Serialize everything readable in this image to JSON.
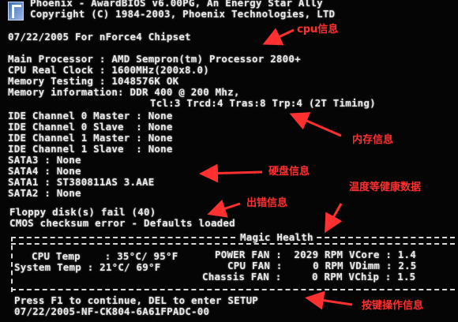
{
  "bios": {
    "header_line1": "Phoenix - AwardBIOS v6.00PG, An Energy Star Ally",
    "header_line2": "Copyright (C) 1984-2003, Phoenix Technologies, LTD",
    "bios_date_line": "07/22/2005 For nForce4 Chipset",
    "main_processor": "Main Processor : AMD Sempron(tm) Processor 2800+",
    "cpu_clock": "CPU Real Clock : 1600MHz(200x8.0)",
    "memory_testing": "Memory Testing : 1048576K OK",
    "memory_info": "Memory information: DDR 400 @ 200 Mhz,",
    "memory_timing": "Tcl:3 Trcd:4 Tras:8 Trp:4 (2T Timing)",
    "ide": [
      "IDE Channel 0 Master : None",
      "IDE Channel 0 Slave  : None",
      "IDE Channel 1 Master : None",
      "IDE Channel 1 Slave  : None"
    ],
    "sata": [
      "SATA3 : None",
      "SATA4 : None",
      "SATA1 : ST380811AS 3.AAE",
      "SATA2 : None"
    ],
    "errors": [
      "Floppy disk(s) fail (40)",
      "CMOS checksum error - Defaults loaded"
    ],
    "health_title": "Magic Health",
    "cpu_temp": "CPU Temp    : 35°C/ 95°F",
    "system_temp": "System Temp : 21°C/ 69°F",
    "power_fan": "POWER FAN :  2029 RPM VCore : 1.4",
    "cpu_fan": "CPU FAN :     0 RPM VDimm : 2.5",
    "chassis_fan": "Chassis FAN :     0 RPM VChip : 1.5",
    "prompt": "Press F1 to continue, DEL to enter SETUP",
    "bios_id": "07/22/2005-NF-CK804-6A61FPADC-00"
  },
  "annotations": {
    "cpu": "cpu信息",
    "memory": "内存信息",
    "disk": "硬盘信息",
    "error": "出错信息",
    "health": "温度等健康数据",
    "keys": "按键操作信息"
  },
  "colors": {
    "annotation": "#ff3030",
    "text": "#eaeaea",
    "background": "#050505"
  }
}
